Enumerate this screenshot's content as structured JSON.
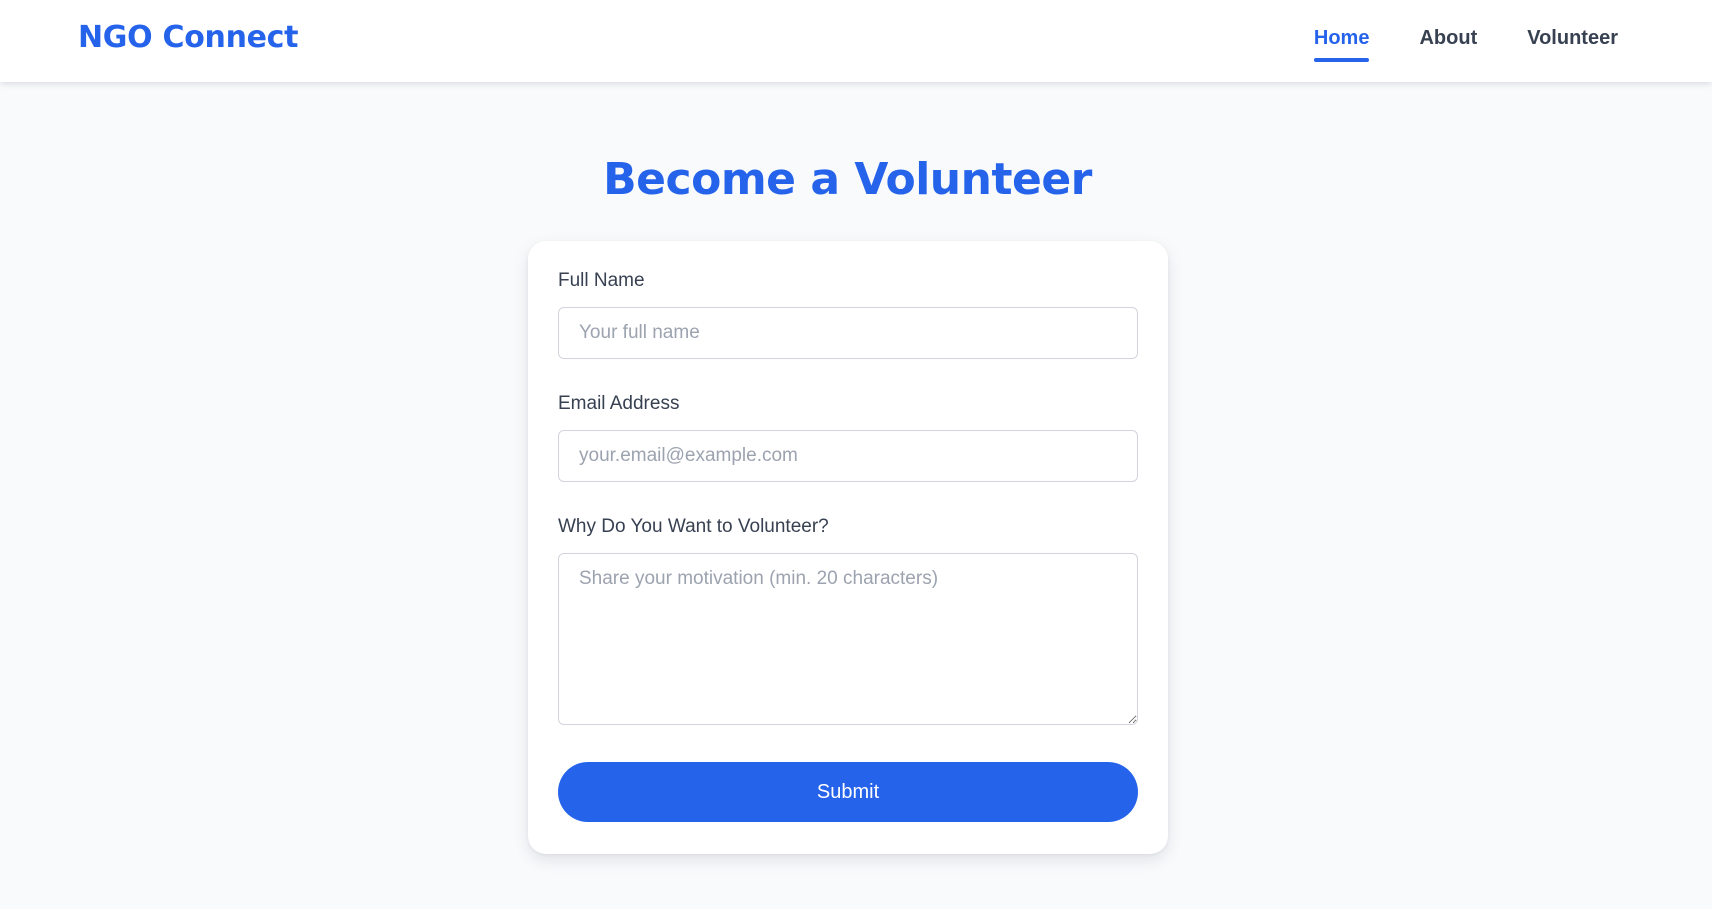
{
  "header": {
    "brand": "NGO Connect",
    "nav": [
      {
        "label": "Home",
        "active": true
      },
      {
        "label": "About",
        "active": false
      },
      {
        "label": "Volunteer",
        "active": false
      }
    ]
  },
  "main": {
    "title": "Become a Volunteer",
    "form": {
      "full_name": {
        "label": "Full Name",
        "value": "",
        "placeholder": "Your full name"
      },
      "email": {
        "label": "Email Address",
        "value": "",
        "placeholder": "your.email@example.com"
      },
      "motivation": {
        "label": "Why Do You Want to Volunteer?",
        "value": "",
        "placeholder": "Share your motivation (min. 20 characters)"
      },
      "submit_label": "Submit"
    }
  },
  "colors": {
    "accent": "#2563eb",
    "page_background": "#f8fafc",
    "card_background": "#ffffff",
    "text": "#374151",
    "placeholder": "#9ca3af",
    "input_border": "#d1d5db"
  }
}
